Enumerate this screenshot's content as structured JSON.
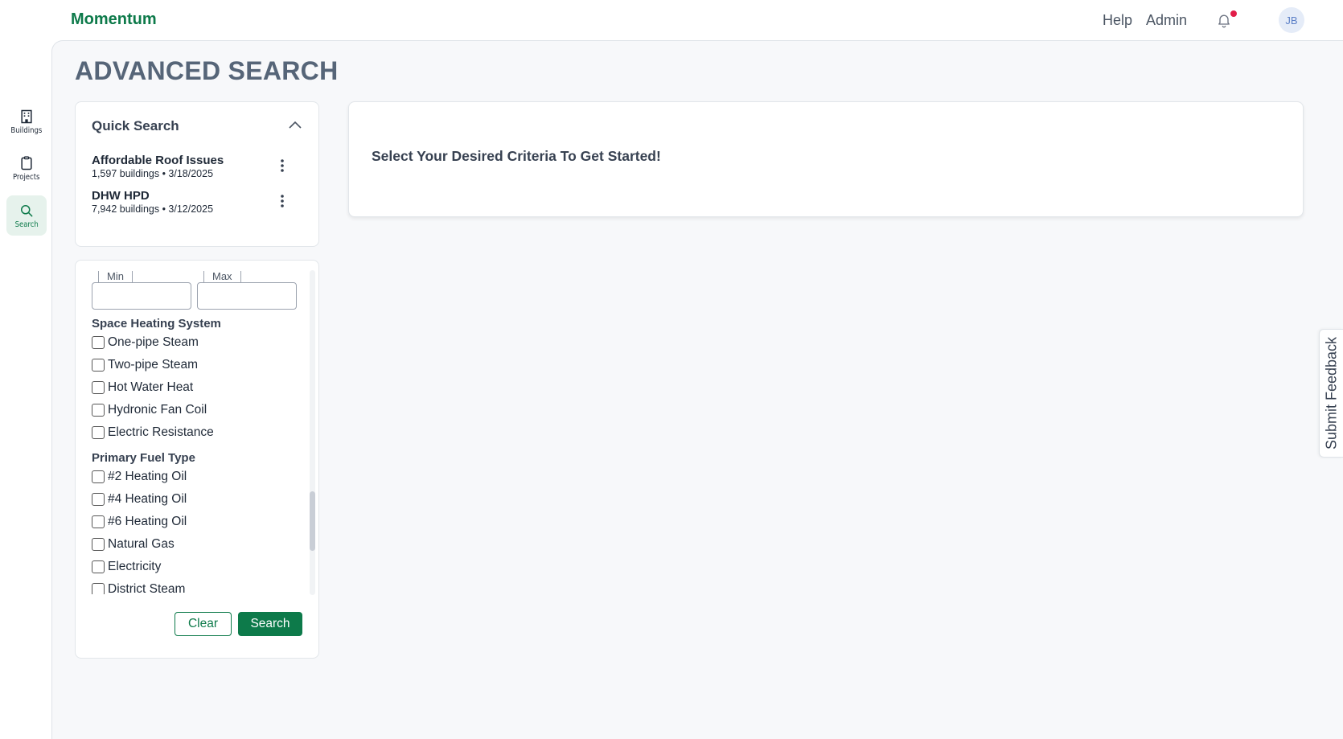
{
  "app": {
    "brand": "Momentum",
    "help_label": "Help",
    "admin_label": "Admin",
    "avatar_initials": "JB",
    "accent_color": "#0d7a4a",
    "notification_dot_color": "#e11d48"
  },
  "sidebar": {
    "items": [
      {
        "label": "Buildings",
        "icon": "building-icon",
        "active": false
      },
      {
        "label": "Projects",
        "icon": "clipboard-icon",
        "active": false
      },
      {
        "label": "Search",
        "icon": "search-icon",
        "active": true
      }
    ]
  },
  "page": {
    "title": "ADVANCED SEARCH"
  },
  "quick_search": {
    "title": "Quick Search",
    "saved": [
      {
        "name": "Affordable Roof Issues",
        "meta": "1,597 buildings • 3/18/2025"
      },
      {
        "name": "DHW HPD",
        "meta": "7,942 buildings • 3/12/2025"
      }
    ]
  },
  "filters": {
    "min_label": "Min",
    "max_label": "Max",
    "groups": [
      {
        "title": "Space Heating System",
        "options": [
          "One-pipe Steam",
          "Two-pipe Steam",
          "Hot Water Heat",
          "Hydronic Fan Coil",
          "Electric Resistance"
        ]
      },
      {
        "title": "Primary Fuel Type",
        "options": [
          "#2 Heating Oil",
          "#4 Heating Oil",
          "#6 Heating Oil",
          "Natural Gas",
          "Electricity",
          "District Steam"
        ]
      }
    ],
    "clear_label": "Clear",
    "search_label": "Search"
  },
  "results": {
    "message": "Select Your Desired Criteria To Get Started!"
  },
  "feedback": {
    "label": "Submit Feedback"
  }
}
